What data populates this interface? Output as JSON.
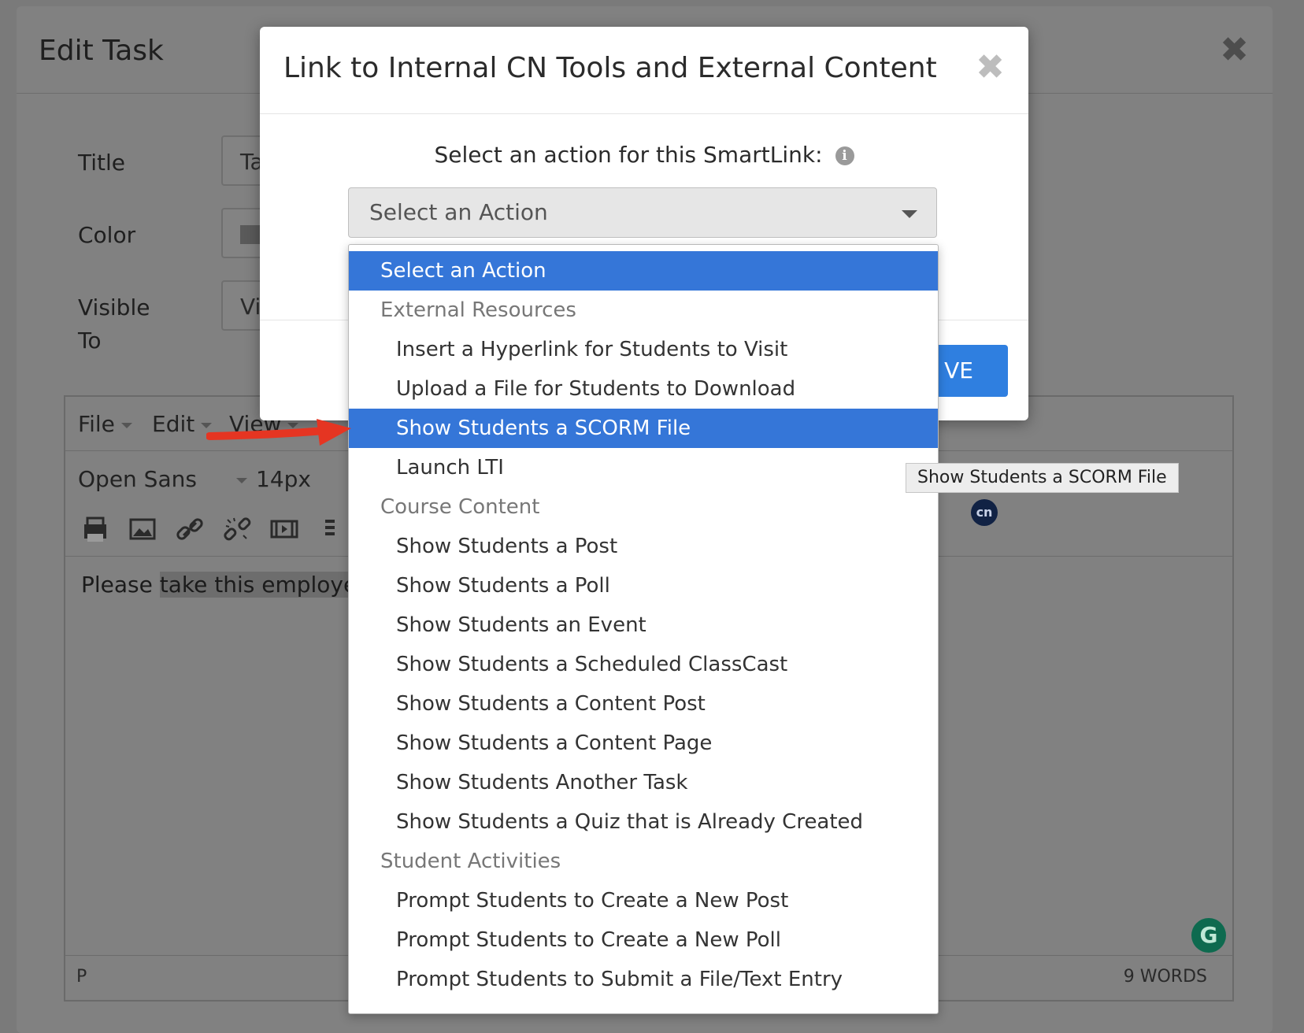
{
  "edit_task": {
    "title": "Edit Task",
    "close": "✖",
    "fields": {
      "title_label": "Title",
      "title_value": "Ta",
      "color_label": "Color",
      "visible_label_line1": "Visible",
      "visible_label_line2": "To",
      "visible_value": "Vi"
    },
    "editor": {
      "menu": [
        "File",
        "Edit",
        "View"
      ],
      "font_family": "Open Sans",
      "font_size": "14px",
      "body_text_plain": "Please ",
      "body_text_highlight": "take this employee",
      "status_element": "P",
      "word_count": "9 WORDS",
      "toolbar_icons": [
        "print-icon",
        "image-icon",
        "link-icon",
        "unlink-icon",
        "media-icon",
        "list-icon"
      ],
      "cn_badge": "cn",
      "grammarly": "G"
    }
  },
  "link_dialog": {
    "title": "Link to Internal CN Tools and External Content",
    "close": "✖",
    "prompt": "Select an action for this SmartLink:",
    "info_icon": "i",
    "select_value": "Select an Action",
    "save_button": "VE"
  },
  "dropdown": {
    "options": [
      {
        "label": "Select an Action",
        "kind": "top",
        "selected": true
      },
      {
        "label": "External Resources",
        "kind": "group"
      },
      {
        "label": "Insert a Hyperlink for Students to Visit",
        "kind": "item"
      },
      {
        "label": "Upload a File for Students to Download",
        "kind": "item"
      },
      {
        "label": "Show Students a SCORM File",
        "kind": "item",
        "selected": true
      },
      {
        "label": "Launch LTI",
        "kind": "item"
      },
      {
        "label": "Course Content",
        "kind": "group"
      },
      {
        "label": "Show Students a Post",
        "kind": "item"
      },
      {
        "label": "Show Students a Poll",
        "kind": "item"
      },
      {
        "label": "Show Students an Event",
        "kind": "item"
      },
      {
        "label": "Show Students a Scheduled ClassCast",
        "kind": "item"
      },
      {
        "label": "Show Students a Content Post",
        "kind": "item"
      },
      {
        "label": "Show Students a Content Page",
        "kind": "item"
      },
      {
        "label": "Show Students Another Task",
        "kind": "item"
      },
      {
        "label": "Show Students a Quiz that is Already Created",
        "kind": "item"
      },
      {
        "label": "Student Activities",
        "kind": "group"
      },
      {
        "label": "Prompt Students to Create a New Post",
        "kind": "item"
      },
      {
        "label": "Prompt Students to Create a New Poll",
        "kind": "item"
      },
      {
        "label": "Prompt Students to Submit a File/Text Entry",
        "kind": "item"
      }
    ]
  },
  "tooltip": "Show Students a SCORM File",
  "colors": {
    "selected_bg": "#3576d8",
    "save_button": "#2f7fe0",
    "arrow": "#e53522"
  }
}
